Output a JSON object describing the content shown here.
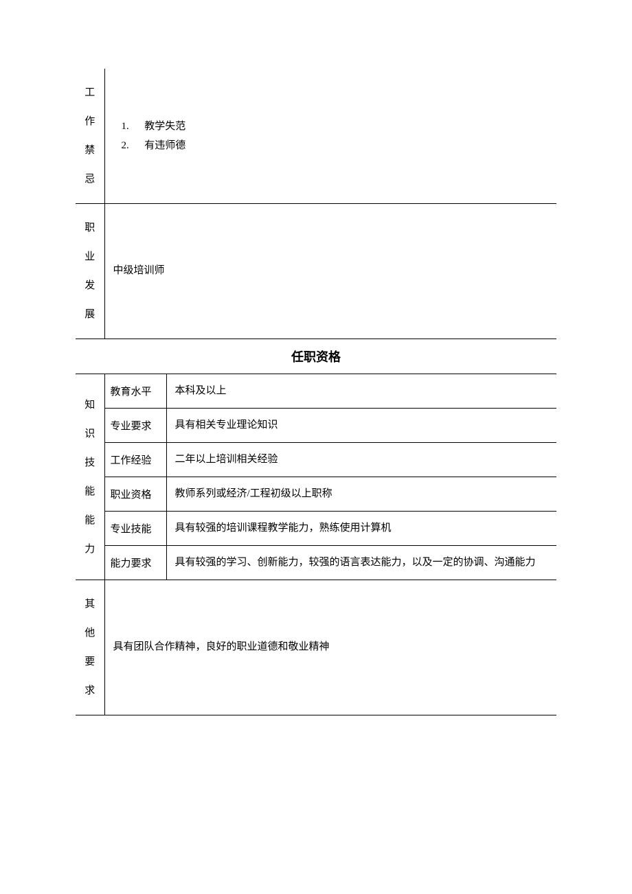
{
  "rows": {
    "r1_label": "工\n作\n禁\n忌",
    "r1_list": [
      {
        "num": "1.",
        "text": "教学失范"
      },
      {
        "num": "2.",
        "text": "有违师德"
      }
    ],
    "r2_label": "职\n业\n发\n展",
    "r2_content": "中级培训师",
    "section_header": "任职资格",
    "skills_label": "知\n识\n技\n能\n能\n力",
    "skills": [
      {
        "label": "教育水平",
        "value": "本科及以上"
      },
      {
        "label": "专业要求",
        "value": "具有相关专业理论知识"
      },
      {
        "label": "工作经验",
        "value": "二年以上培训相关经验"
      },
      {
        "label": "职业资格",
        "value": "教师系列或经济/工程初级以上职称"
      },
      {
        "label": "专业技能",
        "value": "具有较强的培训课程教学能力，熟练使用计算机"
      },
      {
        "label": "能力要求",
        "value": "具有较强的学习、创新能力，较强的语言表达能力，以及一定的协调、沟通能力"
      }
    ],
    "other_label": "其\n他\n要\n求",
    "other_content": "具有团队合作精神，良好的职业道德和敬业精神"
  }
}
